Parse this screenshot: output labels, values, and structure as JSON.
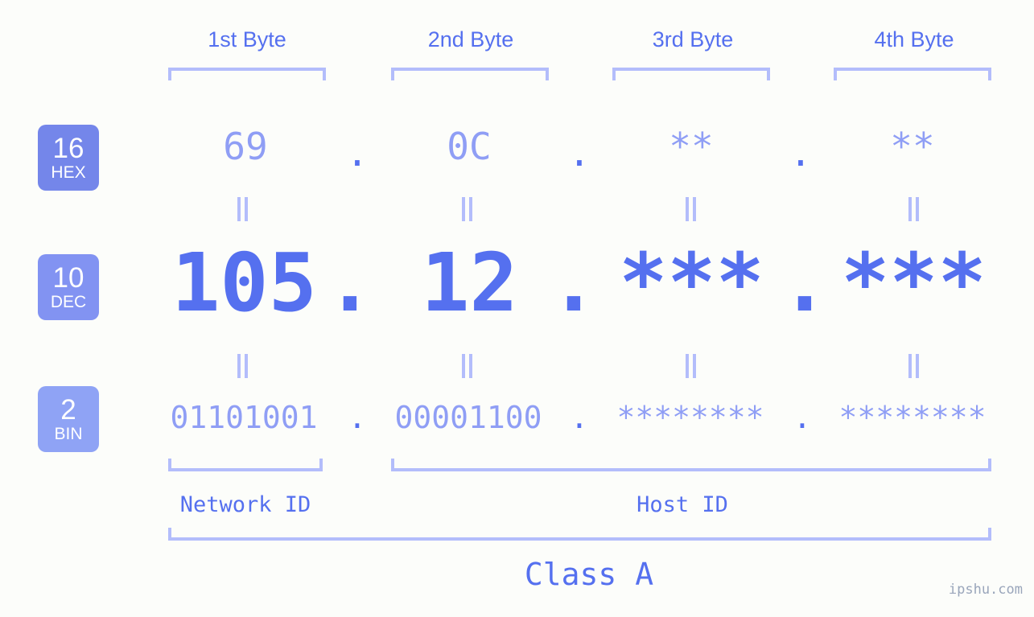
{
  "meta": {
    "background_color": "#fcfdfa",
    "accent_color": "#5570ef",
    "muted_color": "#8f9ef5",
    "bracket_color": "#b3bdfb"
  },
  "byte_headers": [
    {
      "label": "1st Byte"
    },
    {
      "label": "2nd Byte"
    },
    {
      "label": "3rd Byte"
    },
    {
      "label": "4th Byte"
    }
  ],
  "bases": [
    {
      "number": "16",
      "name": "HEX",
      "color": "#7486ea"
    },
    {
      "number": "10",
      "name": "DEC",
      "color": "#8293f2"
    },
    {
      "number": "2",
      "name": "BIN",
      "color": "#8fa3f5"
    }
  ],
  "rows": {
    "hex": {
      "values": [
        "69",
        "0C",
        "**",
        "**"
      ],
      "separator": "."
    },
    "dec": {
      "values": [
        "105",
        "12",
        "***",
        "***"
      ],
      "separator": "."
    },
    "bin": {
      "values": [
        "01101001",
        "00001100",
        "********",
        "********"
      ],
      "separator": "."
    }
  },
  "sections": {
    "network_id": "Network ID",
    "host_id": "Host ID",
    "class": "Class A"
  },
  "watermark": "ipshu.com"
}
